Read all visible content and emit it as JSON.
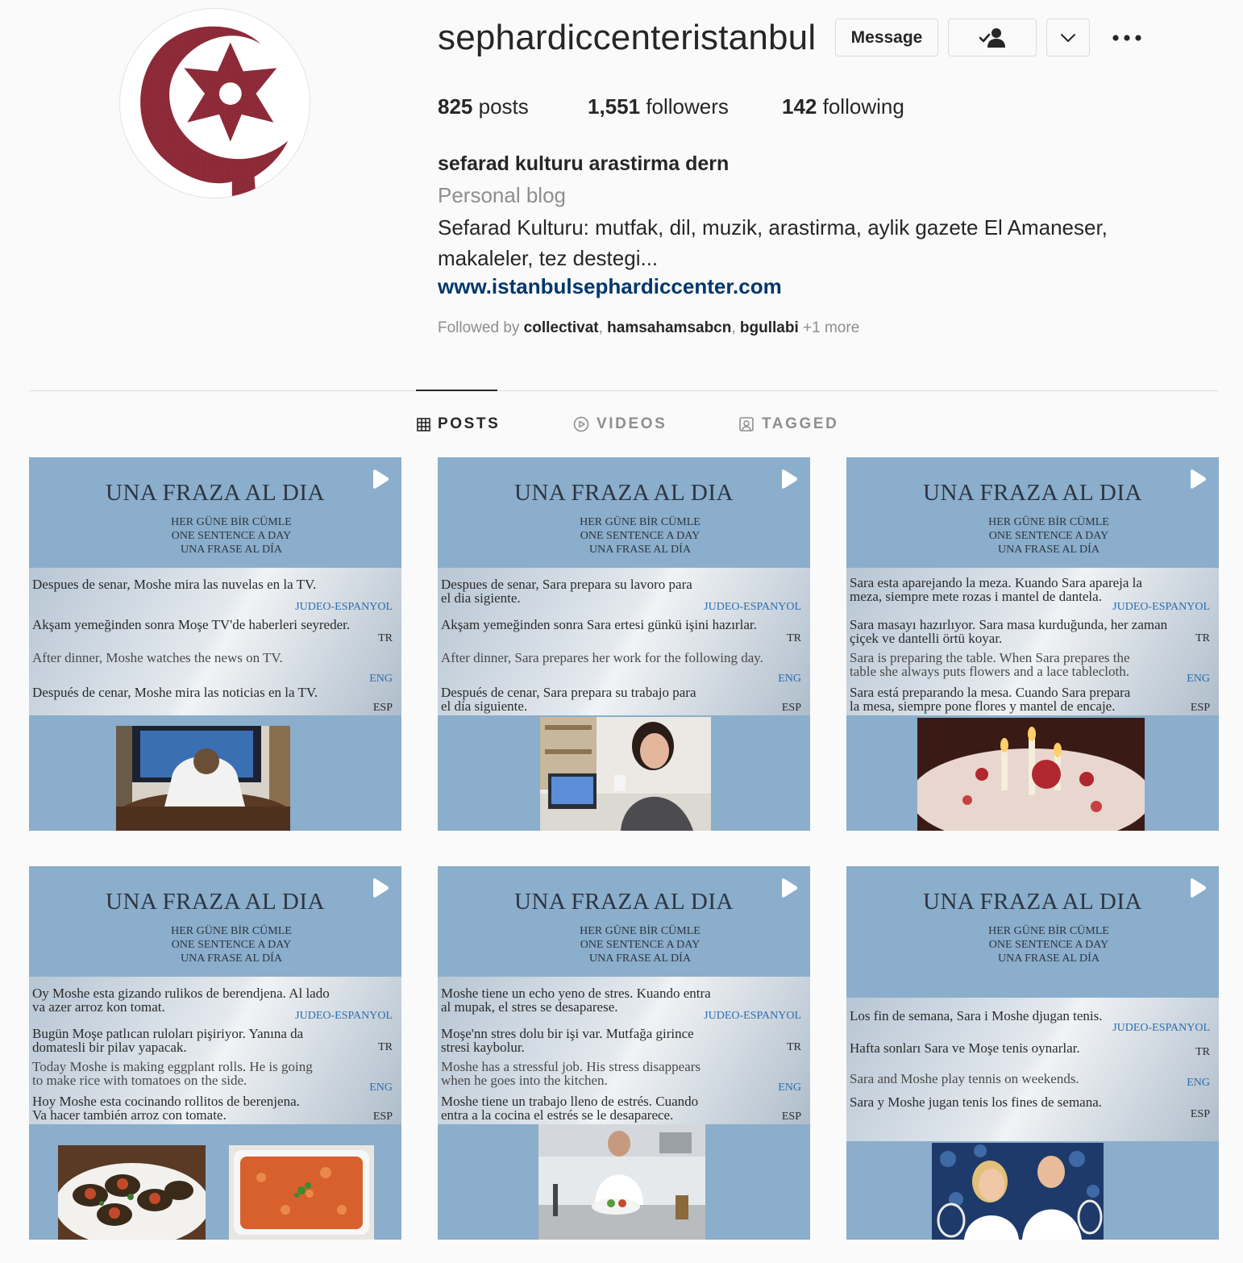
{
  "profile": {
    "username": "sephardiccenteristanbul",
    "message_label": "Message",
    "posts_count": "825",
    "posts_label": "posts",
    "followers_count": "1,551",
    "followers_label": "followers",
    "following_count": "142",
    "following_label": "following",
    "full_name": "sefarad kulturu arastirma dern",
    "category": "Personal blog",
    "bio_line1": "Sefarad Kulturu: mutfak, dil, muzik, arastirma, aylik gazete El Amaneser,",
    "bio_line2": "makaleler, tez destegi...",
    "website": "www.istanbulsephardiccenter.com",
    "followed_by_label": "Followed by",
    "followed_by_users": [
      "collectivat",
      "hamsahamsabcn",
      "bgullabi"
    ],
    "followed_by_more": "+1 more"
  },
  "tabs": [
    {
      "label": "POSTS",
      "icon": "grid-icon",
      "active": true
    },
    {
      "label": "VIDEOS",
      "icon": "play-circle-icon",
      "active": false
    },
    {
      "label": "TAGGED",
      "icon": "tag-person-icon",
      "active": false
    }
  ],
  "colors": {
    "post_background": "#8aaecb",
    "link": "#00376b",
    "avatar_emblem": "#8b2836",
    "tag_blue": "#2e6cae"
  },
  "post_common": {
    "title": "UNA FRAZA AL DIA",
    "sub1": "HER GÜNE BİR CÜMLE",
    "sub2": "ONE SENTENCE A DAY",
    "sub3": "UNA FRASE AL DÍA",
    "tag_je": "JUDEO-ESPANYOL",
    "tag_tr": "TR",
    "tag_eng": "ENG",
    "tag_esp": "ESP"
  },
  "posts": [
    {
      "je": [
        "Despues de senar, Moshe mira las nuvelas en la TV."
      ],
      "tr": [
        "Akşam yemeğinden sonra Moşe TV'de haberleri seyreder."
      ],
      "en": [
        "After dinner, Moshe watches the news on TV."
      ],
      "es": [
        "Después de cenar, Moshe mira las noticias en la TV."
      ],
      "image": "man watching tv"
    },
    {
      "je": [
        "Despues de senar, Sara prepara su lavoro para",
        "el dia sigiente."
      ],
      "tr": [
        "Akşam yemeğinden sonra Sara ertesi günkü işini hazırlar."
      ],
      "en": [
        "After dinner, Sara prepares her work for the following day."
      ],
      "es": [
        "Después de cenar, Sara prepara su trabajo para",
        "el día siguiente."
      ],
      "image": "woman at laptop"
    },
    {
      "je": [
        "Sara esta aparejando la meza. Kuando Sara apareja la",
        "meza, siempre mete rozas i mantel de dantela."
      ],
      "tr": [
        "Sara masayı hazırlıyor. Sara masa kurduğunda, her zaman",
        "çiçek ve dantelli örtü koyar."
      ],
      "en": [
        "Sara is preparing the table. When Sara prepares the",
        "table she always puts flowers and a lace tablecloth."
      ],
      "es": [
        "Sara está preparando la mesa. Cuando Sara prepara",
        "la mesa, siempre pone flores y mantel de encaje."
      ],
      "image": "candle lit table"
    },
    {
      "je": [
        "Oy Moshe esta gizando rulikos de berendjena. Al lado",
        "va azer arroz kon tomat."
      ],
      "tr": [
        "Bugün Moşe patlıcan ruloları pişiriyor. Yanına da",
        "domatesli bir pilav yapacak."
      ],
      "en": [
        "Today Moshe is making eggplant rolls. He is going",
        "to make rice with tomatoes on the side."
      ],
      "es": [
        "Hoy Moshe esta cocinando rollitos de berenjena.",
        "Va hacer también arroz con tomate."
      ],
      "image": "eggplant rolls and tomato rice"
    },
    {
      "je": [
        "Moshe tiene un echo yeno de stres. Kuando entra",
        "al mupak, el stres se desaparese."
      ],
      "tr": [
        "Moşe'nn stres dolu bir işi var. Mutfağa girince",
        "stresi kaybolur."
      ],
      "en": [
        "Moshe has a stressful job. His stress disappears",
        "when he goes into the kitchen."
      ],
      "es": [
        "Moshe tiene un trabajo lleno de estrés. Cuando",
        "entra a la cocina el estrés se le desaparece."
      ],
      "image": "man cooking in kitchen"
    },
    {
      "je": [
        "Los fin de semana, Sara i Moshe djugan tenis."
      ],
      "tr": [
        "Hafta sonları Sara ve Moşe tenis oynarlar."
      ],
      "en": [
        "Sara and Moshe play tennis on weekends."
      ],
      "es": [
        "Sara y Moshe jugan tenis los fines de semana."
      ],
      "image": "couple with tennis rackets"
    }
  ]
}
